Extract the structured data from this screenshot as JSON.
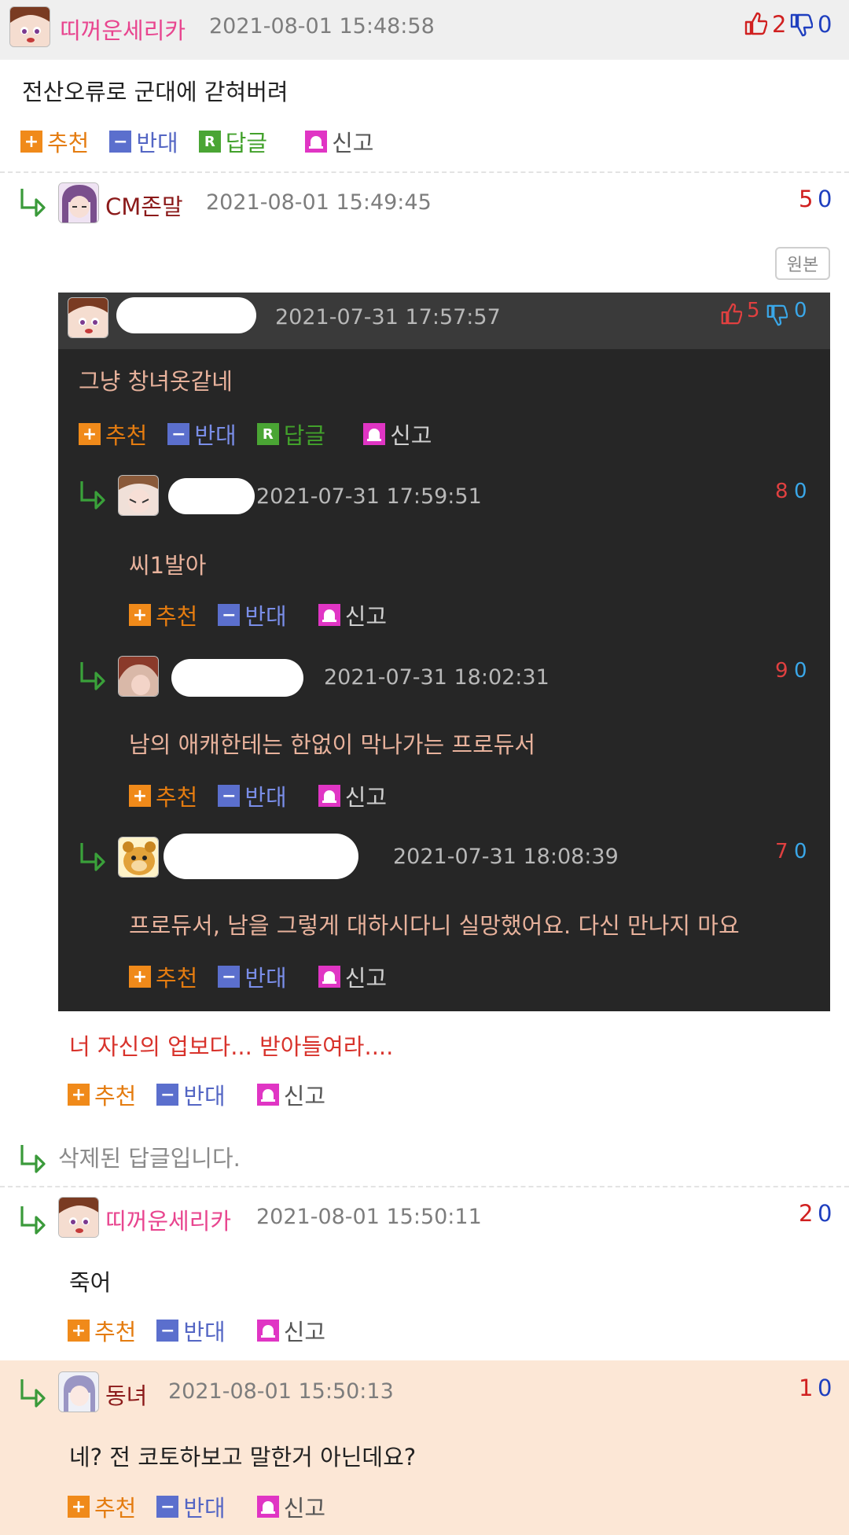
{
  "comments": [
    {
      "nick": "띠꺼운세리카",
      "time": "2021-08-01 15:48:58",
      "up": "2",
      "down": "0",
      "text": "전산오류로 군대에 갇혀버려"
    },
    {
      "nick": "CM존말",
      "time": "2021-08-01 15:49:45",
      "up": "5",
      "down": "0",
      "original_btn": "원본",
      "embedded": {
        "main": {
          "time": "2021-07-31 17:57:57",
          "up": "5",
          "down": "0",
          "text": "그냥 창녀옷같네"
        },
        "replies": [
          {
            "time": "2021-07-31 17:59:51",
            "up": "8",
            "down": "0",
            "text": "씨1발아"
          },
          {
            "time": "2021-07-31 18:02:31",
            "up": "9",
            "down": "0",
            "text": "남의 애캐한테는 한없이 막나가는 프로듀서"
          },
          {
            "time": "2021-07-31 18:08:39",
            "up": "7",
            "down": "0",
            "text": "프로듀서, 남을 그렇게 대하시다니 실망했어요. 다신 만나지 마요"
          }
        ]
      },
      "text": "너 자신의 업보다... 받아들여라...."
    },
    {
      "deleted_text": "삭제된 답글입니다."
    },
    {
      "nick": "띠꺼운세리카",
      "time": "2021-08-01 15:50:11",
      "up": "2",
      "down": "0",
      "text": "죽어"
    },
    {
      "nick": "동녀",
      "time": "2021-08-01 15:50:13",
      "up": "1",
      "down": "0",
      "text": "네? 전 코토하보고 말한거 아닌데요?"
    }
  ],
  "labels": {
    "recommend": "추천",
    "oppose": "반대",
    "reply": "답글",
    "report": "신고",
    "reply_icon": "R"
  },
  "colors": {
    "nick_pink": "#e8458f",
    "nick_darkred": "#8b1a1a",
    "up_red": "#d02020",
    "down_blue": "#1f3fbf",
    "red_comment": "#d8332c",
    "highlight_bg": "#fce7d6",
    "embed_bg": "#262626"
  },
  "icons": [
    "thumbs-up-icon",
    "thumbs-down-icon",
    "reply-arrow-icon",
    "plus-icon",
    "minus-icon",
    "reply-icon",
    "siren-icon"
  ]
}
